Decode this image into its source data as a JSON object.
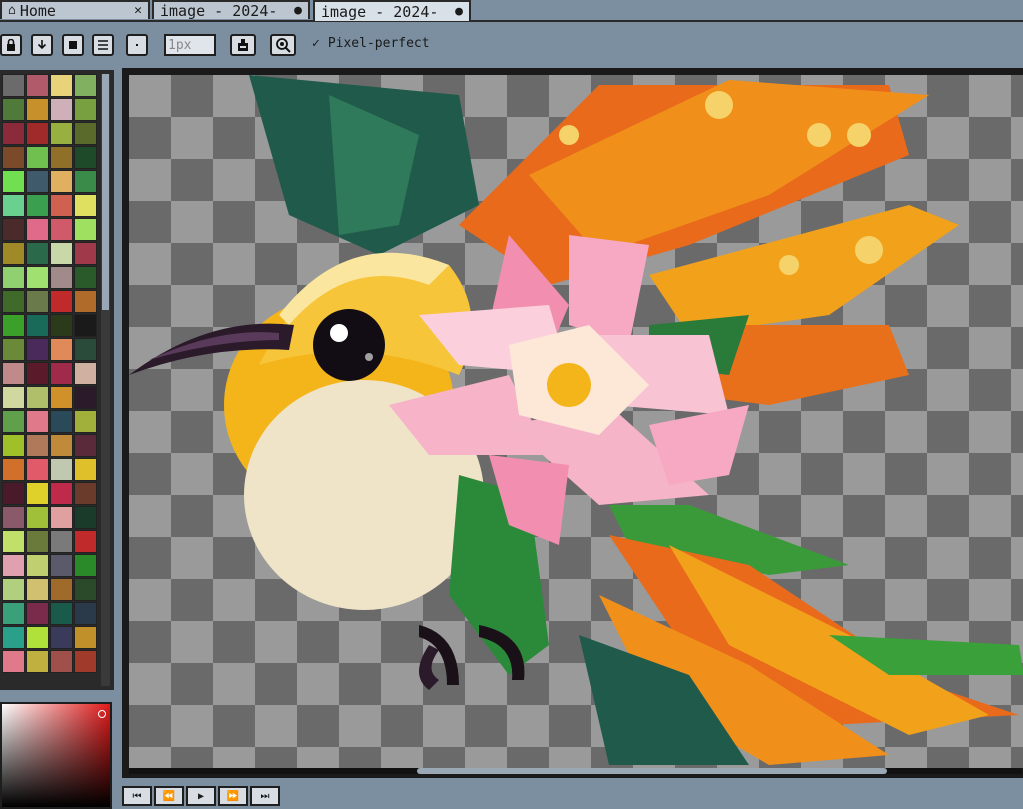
{
  "tabs": [
    {
      "label": "Home",
      "icon": "home-icon",
      "close": "✕"
    },
    {
      "label": "image - 2024-",
      "status": "●"
    },
    {
      "label": "image - 2024-",
      "status": "●",
      "active": true
    }
  ],
  "toolbar": {
    "buttons": [
      "lock-icon",
      "download-icon",
      "stop-icon",
      "menu-icon",
      "dot-icon"
    ],
    "brush_size_placeholder": "1px",
    "pixel_perfect_label": "Pixel-perfect",
    "pixel_perfect_checked": true,
    "pixel_perfect_check": "✓"
  },
  "palette": {
    "colors": [
      "#6b6b6b",
      "#b05a6a",
      "#e8d27a",
      "#80b060",
      "#4f7a3a",
      "#c8902a",
      "#d0b0b8",
      "#78a040",
      "#8a2a3a",
      "#a02a2a",
      "#98b040",
      "#5a6a2a",
      "#7a4a2a",
      "#70c050",
      "#907028",
      "#1f4a2a",
      "#70e050",
      "#3f5a6a",
      "#e0b060",
      "#3a8a4a",
      "#6ad090",
      "#3aa050",
      "#d06050",
      "#e0e060",
      "#4a2a2a",
      "#e06a8a",
      "#d05a6a",
      "#a0e060",
      "#a08a28",
      "#2a6a4a",
      "#c8d8a8",
      "#a03a4a",
      "#90d070",
      "#a0e070",
      "#a08a8a",
      "#2a5a2a",
      "#3f6a2a",
      "#6a7a4a",
      "#c02a2a",
      "#b06a2a",
      "#3aa02a",
      "#1a6a5a",
      "#2a3a1a",
      "#1a1a1a",
      "#6a8a3a",
      "#4a2a5a",
      "#e08a5a",
      "#2a4a3a",
      "#c08a8a",
      "#5a1a2a",
      "#a02a4a",
      "#d0b0a0",
      "#d0d8a0",
      "#b0c06a",
      "#d0902a",
      "#2a1a2a",
      "#60a04a",
      "#e07a8a",
      "#2a4a5a",
      "#a0b03a",
      "#a0c02a",
      "#b07a5a",
      "#c08a3a",
      "#5a2a3a",
      "#d0702a",
      "#e05a6a",
      "#c0c8b0",
      "#e0c02a",
      "#4a1a2a",
      "#e0d02a",
      "#c02a4a",
      "#6a3a2a",
      "#8a5a6a",
      "#a0c03a",
      "#e0a0a0",
      "#1a3a2a",
      "#c0e06a",
      "#6a7a3a",
      "#7a7a7a",
      "#c02a2a",
      "#e0a0b0",
      "#c0d070",
      "#5a5a6a",
      "#2a8a2a",
      "#b0d080",
      "#d0c070",
      "#a06a2a",
      "#2a4a2a",
      "#3aa07a",
      "#7a2a4a",
      "#1a5a4a",
      "#2a3a4a",
      "#2aa08a",
      "#b0e03a",
      "#3a3a5a",
      "#c0902a",
      "#e07a8a",
      "#c0b040",
      "#a0504a",
      "#a03a2a"
    ]
  },
  "playback": {
    "buttons": [
      "⏮",
      "⏪",
      "▶",
      "⏩",
      "⏭"
    ]
  },
  "colors": {
    "background": "#7b8fa0",
    "tab_bg": "#bcc6d0",
    "tab_active_bg": "#d8e0e8",
    "checker_light": "#9a9a9a",
    "checker_dark": "#6a6a6a"
  }
}
